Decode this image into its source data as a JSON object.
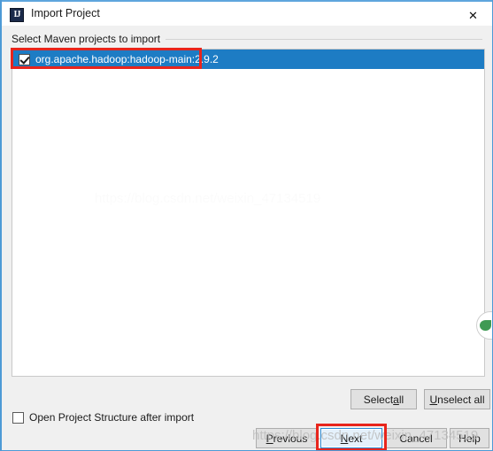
{
  "window": {
    "title": "Import Project",
    "app_icon": "intellij-idea-icon",
    "icon_text": "IJ",
    "close_label": "✕",
    "accent_color": "#5ea5dd"
  },
  "section": {
    "label": "Select Maven projects to import"
  },
  "project_list": {
    "rows": [
      {
        "label": "org.apache.hadoop:hadoop-main:2.9.2",
        "checked": true,
        "selected": true
      }
    ],
    "selection_color": "#1d7cc4"
  },
  "list_actions": {
    "select_all": {
      "pre": "Select ",
      "mnemonic": "a",
      "post": "ll"
    },
    "unselect_all": {
      "pre": "",
      "mnemonic": "U",
      "post": "nselect all"
    }
  },
  "options": {
    "open_project_structure": {
      "pre": "",
      "mnemonic": "O",
      "post": "pen Project Structure after import",
      "checked": false
    }
  },
  "nav_buttons": {
    "previous": {
      "pre": "",
      "mnemonic": "P",
      "post": "revious"
    },
    "next": {
      "pre": "",
      "mnemonic": "N",
      "post": "ext",
      "default": true
    },
    "cancel": {
      "pre": "Cancel",
      "mnemonic": "",
      "post": ""
    },
    "help": {
      "pre": "Help",
      "mnemonic": "",
      "post": ""
    }
  },
  "annotations": {
    "color": "#e8251c",
    "boxes": [
      {
        "name": "project-row-highlight"
      },
      {
        "name": "next-button-highlight"
      }
    ]
  },
  "watermark": {
    "text": "https://blog.csdn.net/weixin_47134519",
    "logo": "csdn-logo"
  }
}
